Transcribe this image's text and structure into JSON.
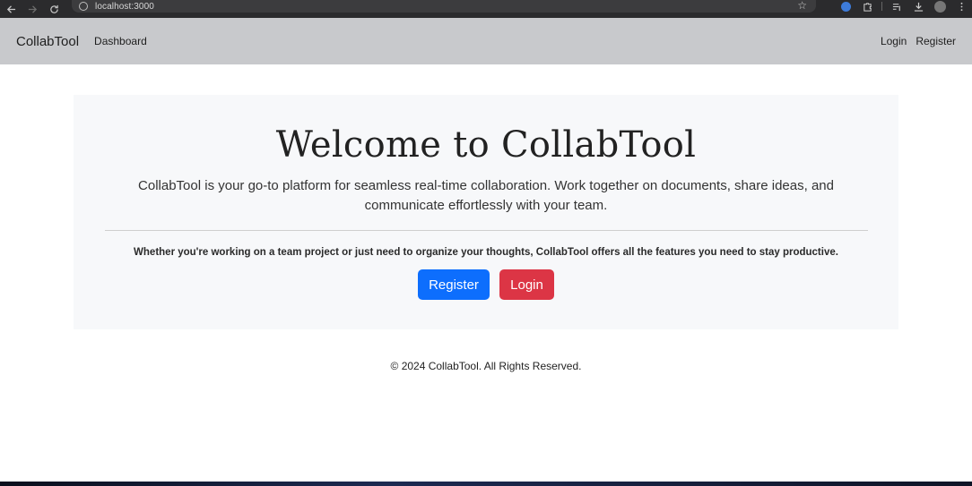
{
  "browser": {
    "url": "localhost:3000",
    "icons": [
      "back-icon",
      "forward-icon",
      "reload-icon",
      "site-info-icon",
      "bookmark-star-icon",
      "extension-icon",
      "puzzle-icon",
      "reading-list-icon",
      "download-icon",
      "profile-avatar",
      "more-vert-icon"
    ]
  },
  "navbar": {
    "brand": "CollabTool",
    "dashboard_label": "Dashboard",
    "login_label": "Login",
    "register_label": "Register"
  },
  "hero": {
    "title": "Welcome to CollabTool",
    "lead": "CollabTool is your go-to platform for seamless real-time collaboration. Work together on documents, share ideas, and communicate effortlessly with your team.",
    "subtext": "Whether you're working on a team project or just need to organize your thoughts, CollabTool offers all the features you need to stay productive.",
    "register_button": "Register",
    "login_button": "Login"
  },
  "footer": {
    "copyright": "© 2024 CollabTool. All Rights Reserved."
  },
  "colors": {
    "navbar_bg": "#c8c9cc",
    "hero_bg": "#f7f8fa",
    "primary": "#0d6efd",
    "danger": "#dc3545"
  }
}
